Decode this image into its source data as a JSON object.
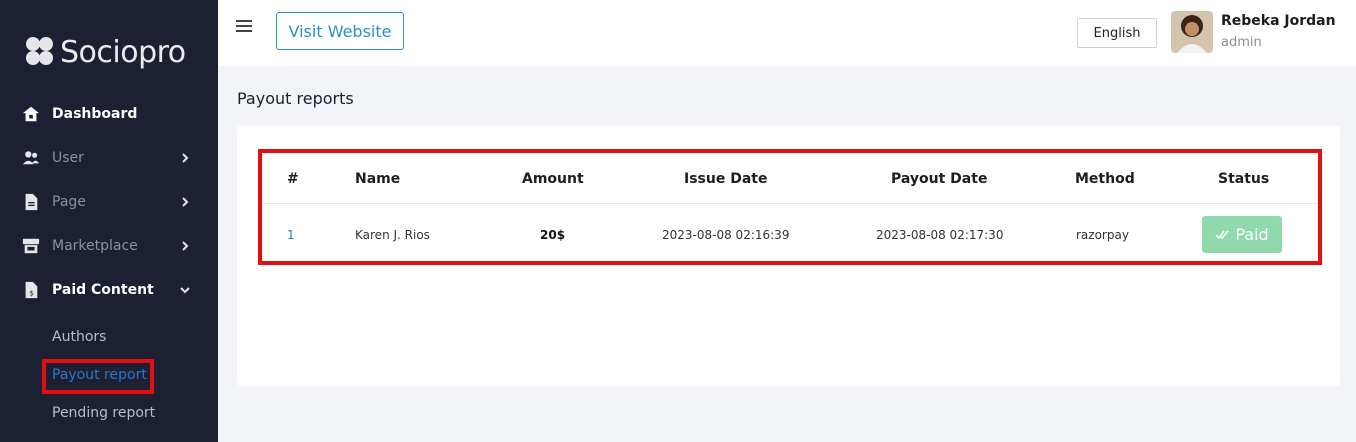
{
  "app": {
    "name": "Sociopro"
  },
  "sidebar": {
    "items": [
      {
        "label": "Dashboard",
        "icon": "home-icon"
      },
      {
        "label": "User",
        "icon": "users-icon"
      },
      {
        "label": "Page",
        "icon": "file-icon"
      },
      {
        "label": "Marketplace",
        "icon": "store-icon"
      },
      {
        "label": "Paid Content",
        "icon": "file-dollar-icon"
      }
    ],
    "subitems": [
      {
        "label": "Authors"
      },
      {
        "label": "Payout report"
      },
      {
        "label": "Pending report"
      }
    ]
  },
  "topbar": {
    "visit_website": "Visit Website",
    "language": "English",
    "user_name": "Rebeka Jordan",
    "user_role": "admin"
  },
  "page": {
    "title": "Payout reports"
  },
  "table": {
    "headers": [
      "#",
      "Name",
      "Amount",
      "Issue Date",
      "Payout Date",
      "Method",
      "Status"
    ],
    "rows": [
      {
        "index": "1",
        "name": "Karen J. Rios",
        "amount": "20$",
        "issue_date": "2023-08-08 02:16:39",
        "payout_date": "2023-08-08 02:17:30",
        "method": "razorpay",
        "status": "Paid"
      }
    ]
  },
  "colors": {
    "sidebar_bg": "#1c2032",
    "accent": "#2b8fcf",
    "status_paid": "#8fd9ad",
    "highlight": "#e10f0f"
  }
}
